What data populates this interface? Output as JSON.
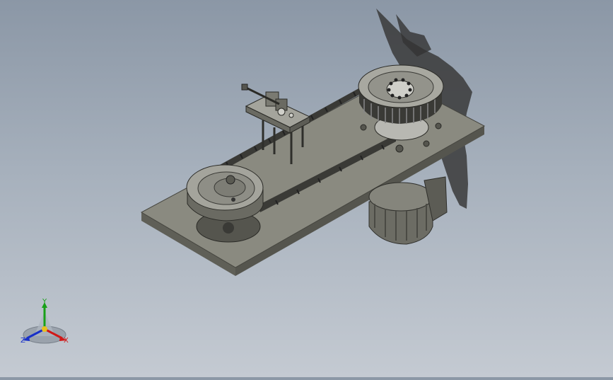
{
  "viewport": {
    "background_top": "#8b97a6",
    "background_bottom": "#c4cad2",
    "model_colors": {
      "plate_top": "#8a8a80",
      "plate_side": "#5f5f57",
      "metal": "#9a9a92",
      "dark": "#3a3a36",
      "shadow": "#3a3a3a"
    }
  },
  "triad": {
    "x_label": "X",
    "y_label": "Y",
    "z_label": "Z",
    "x_color": "#d01818",
    "y_color": "#18a018",
    "z_color": "#1830c8"
  }
}
